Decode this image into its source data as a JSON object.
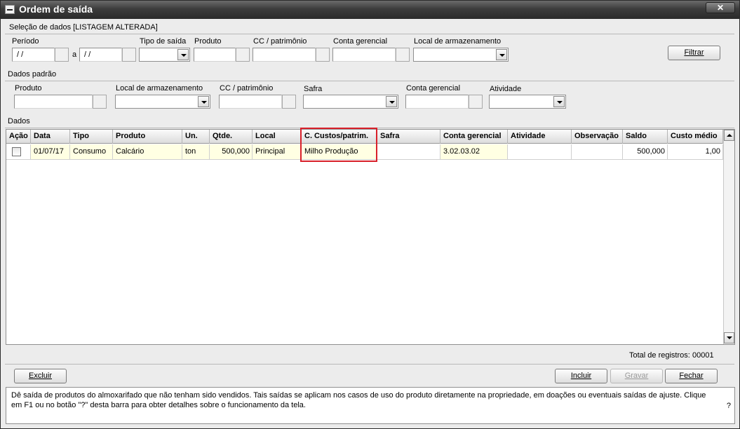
{
  "window": {
    "title": "Ordem de saída",
    "close_label": "✕"
  },
  "selection": {
    "title": "Seleção de dados [LISTAGEM ALTERADA]",
    "periodo_label": "Período",
    "periodo_from": " / /",
    "periodo_sep": "a",
    "periodo_to": " / /",
    "tipo_label": "Tipo de saída",
    "produto_label": "Produto",
    "cc_label": "CC / patrimônio",
    "conta_label": "Conta gerencial",
    "local_label": "Local de armazenamento",
    "filtrar_label": "Filtrar"
  },
  "defaults": {
    "title": "Dados padrão",
    "produto_label": "Produto",
    "local_label": "Local de armazenamento",
    "cc_label": "CC / patrimônio",
    "safra_label": "Safra",
    "conta_label": "Conta gerencial",
    "atividade_label": "Atividade"
  },
  "data": {
    "title": "Dados",
    "columns": [
      "Ação",
      "Data",
      "Tipo",
      "Produto",
      "Un.",
      "Qtde.",
      "Local",
      "C. Custos/patrim.",
      "Safra",
      "Conta gerencial",
      "Atividade",
      "Observação",
      "Saldo",
      "Custo médio"
    ],
    "rows": [
      {
        "data": "01/07/17",
        "tipo": "Consumo",
        "produto": "Calcário",
        "un": "ton",
        "qtde": "500,000",
        "local": "Principal",
        "cc": "Milho Produção",
        "safra": "",
        "conta": "3.02.03.02",
        "atividade": "",
        "obs": "",
        "saldo": "500,000",
        "custo": "1,00"
      }
    ],
    "total_label": "Total de registros:",
    "total_value": "00001"
  },
  "actions": {
    "excluir": "Excluir",
    "incluir": "Incluir",
    "gravar": "Gravar",
    "fechar": "Fechar"
  },
  "help": {
    "text": "Dê saída de produtos do almoxarifado que não tenham sido vendidos. Tais saídas se aplicam nos casos de uso do produto diretamente na propriedade, em doações ou eventuais saídas de ajuste. Clique em F1 ou no botão \"?\" desta barra para obter detalhes sobre o funcionamento da tela.",
    "q": "?"
  },
  "colors": {
    "highlight": "#d9202a",
    "editable_cell": "#ffffe3"
  }
}
